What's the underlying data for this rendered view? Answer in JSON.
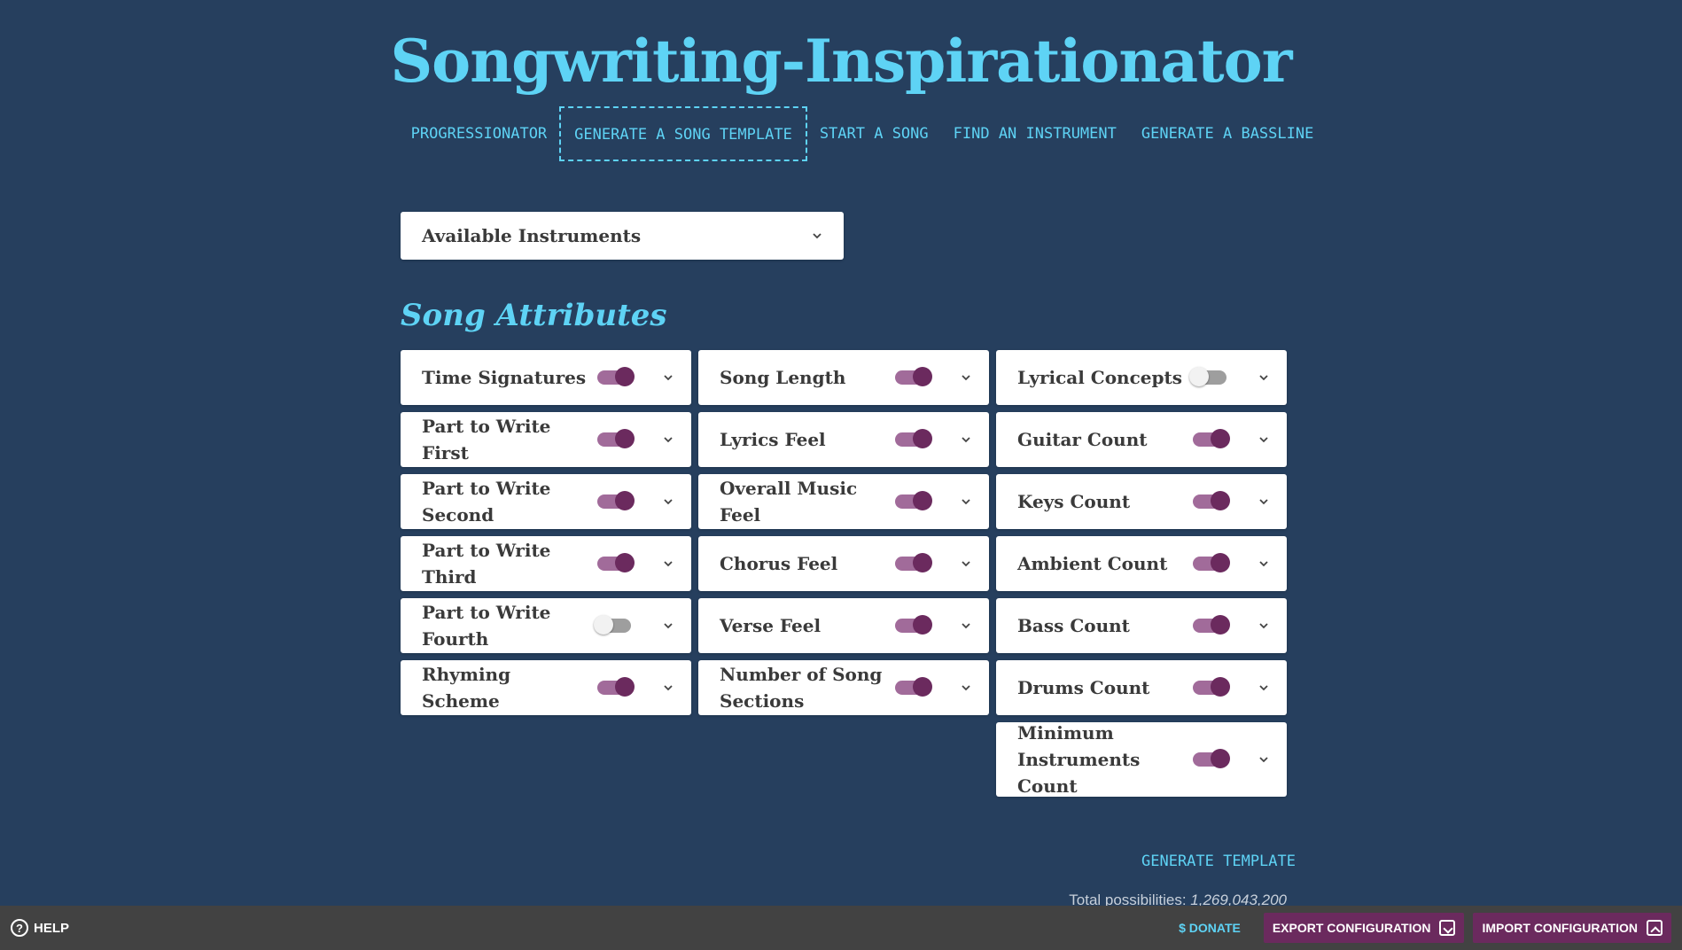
{
  "app": {
    "title": "Songwriting-Inspirationator"
  },
  "nav": {
    "items": [
      {
        "label": "Progressionator",
        "active": false
      },
      {
        "label": "Generate a Song Template",
        "active": true
      },
      {
        "label": "Start a Song",
        "active": false
      },
      {
        "label": "Find an Instrument",
        "active": false
      },
      {
        "label": "Generate a Bassline",
        "active": false
      }
    ]
  },
  "instruments": {
    "label": "Available Instruments"
  },
  "attributes": {
    "heading": "Song Attributes",
    "columns": [
      [
        {
          "label": "Time Signatures",
          "enabled": true
        },
        {
          "label": "Part to Write First",
          "enabled": true
        },
        {
          "label": "Part to Write Second",
          "enabled": true
        },
        {
          "label": "Part to Write Third",
          "enabled": true
        },
        {
          "label": "Part to Write Fourth",
          "enabled": false
        },
        {
          "label": "Rhyming Scheme",
          "enabled": true
        }
      ],
      [
        {
          "label": "Song Length",
          "enabled": true
        },
        {
          "label": "Lyrics Feel",
          "enabled": true
        },
        {
          "label": "Overall Music Feel",
          "enabled": true
        },
        {
          "label": "Chorus Feel",
          "enabled": true
        },
        {
          "label": "Verse Feel",
          "enabled": true
        },
        {
          "label": "Number of Song Sections",
          "enabled": true
        }
      ],
      [
        {
          "label": "Lyrical Concepts",
          "enabled": false
        },
        {
          "label": "Guitar Count",
          "enabled": true
        },
        {
          "label": "Keys Count",
          "enabled": true
        },
        {
          "label": "Ambient Count",
          "enabled": true
        },
        {
          "label": "Bass Count",
          "enabled": true
        },
        {
          "label": "Drums Count",
          "enabled": true
        },
        {
          "label": "Minimum Instruments Count",
          "enabled": true
        }
      ]
    ]
  },
  "generate": {
    "label": "Generate Template",
    "possibilities_label": "Total possibilities:",
    "possibilities_value": "1,269,043,200"
  },
  "bottom_bar": {
    "help": "HELP",
    "donate": "$ DONATE",
    "export": "EXPORT CONFIGURATION",
    "import": "IMPORT CONFIGURATION"
  },
  "colors": {
    "background": "#263f5e",
    "accent": "#5ed3f5",
    "toggle_on": "#6b2a5e",
    "bar": "#424242"
  }
}
